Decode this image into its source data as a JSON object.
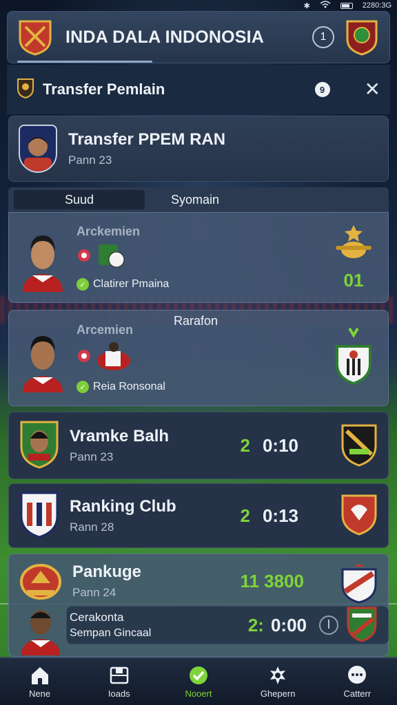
{
  "status_bar": {
    "time": "2280:3G"
  },
  "header": {
    "title": "INDA DALA INDONOSIA",
    "badge_count": "1"
  },
  "transfer_bar": {
    "title": "Transfer Pemlain",
    "info_glyph": "9",
    "close_glyph": "✕"
  },
  "player_card": {
    "name": "Transfer PPEM RAN",
    "subtitle": "Pann 23"
  },
  "tabs": [
    {
      "label": "Suud"
    },
    {
      "label": "Syomain"
    }
  ],
  "rows": [
    {
      "name": "Arckemien",
      "caption": "Clatirer Pmaina",
      "value": "01"
    },
    {
      "name": "Arcemien",
      "caption": "Reia Ronsonal",
      "overlay": "Rarafon"
    },
    {
      "name": "Vramke Balh",
      "subtitle": "Pann 23",
      "score_left": "2",
      "score_right": "0:10"
    },
    {
      "name": "Ranking Club",
      "subtitle": "Rann 28",
      "score_left": "2",
      "score_right": "0:13"
    },
    {
      "name": "Pankuge",
      "subtitle": "Pann 24",
      "score_left": "11 3800"
    },
    {
      "name": "Cerakonta",
      "subtitle": "Sempan Gincaal",
      "score_left": "2:",
      "score_right": "0:00"
    }
  ],
  "nav": [
    {
      "label": "Nene",
      "icon": "home-icon"
    },
    {
      "label": "Ioads",
      "icon": "squad-icon"
    },
    {
      "label": "Nooert",
      "icon": "check-icon"
    },
    {
      "label": "Ghepern",
      "icon": "settings-icon"
    },
    {
      "label": "Catterr",
      "icon": "chat-icon"
    }
  ],
  "colors": {
    "accent_green": "#7fd43a",
    "panel": "#26354b",
    "active_tab": "#1b2638"
  }
}
